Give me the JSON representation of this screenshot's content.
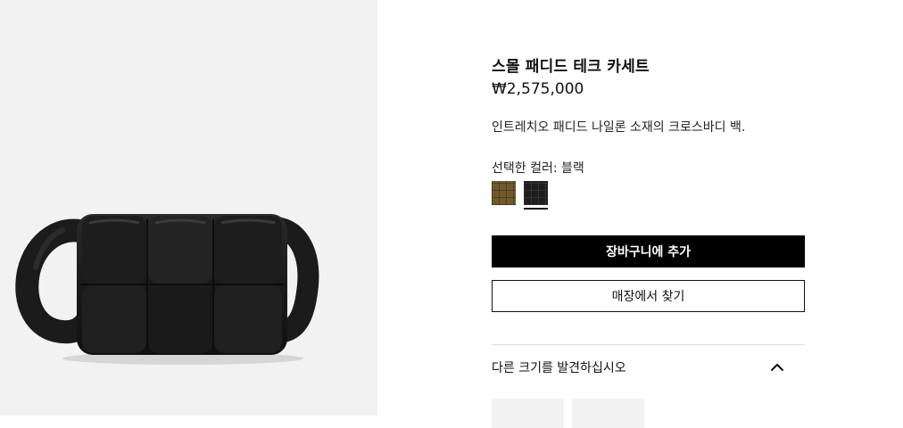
{
  "product": {
    "name": "스몰 패디드 테크 카세트",
    "price": "₩2,575,000",
    "description": "인트레치오 패디드 나일론 소재의 크로스바디 백."
  },
  "color_selector": {
    "label": "선택한 컬러:",
    "selected_value": "블랙",
    "swatches": [
      {
        "name": "khaki",
        "color": "#6e5a2c",
        "selected": false
      },
      {
        "name": "black",
        "color": "#1e1e1e",
        "selected": true
      }
    ]
  },
  "actions": {
    "add_to_cart": "장바구니에 추가",
    "find_in_store": "매장에서 찾기"
  },
  "sizes_section": {
    "label": "다른 크기를 발견하십시오",
    "expanded": true,
    "icon": "chevron-up-icon"
  },
  "colors": {
    "image_background": "#f2f2f2",
    "primary_button": "#000000",
    "divider": "#dcdcdc"
  }
}
